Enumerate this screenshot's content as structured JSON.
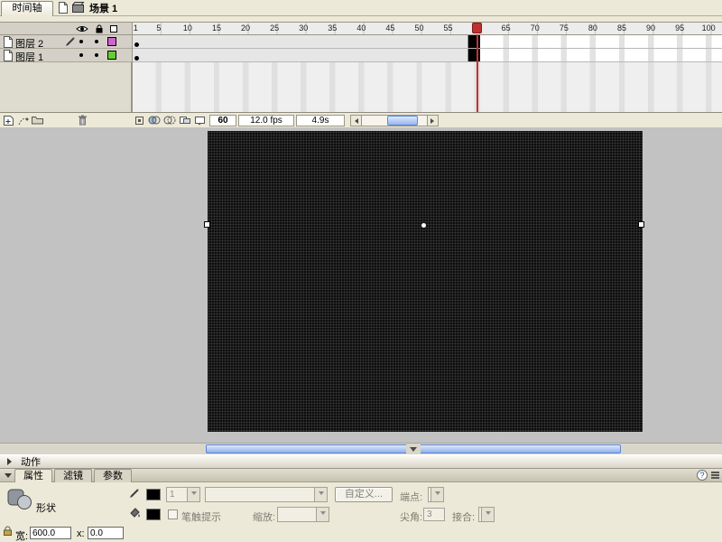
{
  "top": {
    "timeline_tab": "时间轴",
    "scene_label": "场景 1"
  },
  "timeline": {
    "ruler_frames": [
      1,
      5,
      10,
      15,
      20,
      25,
      30,
      35,
      40,
      45,
      50,
      55,
      60,
      65,
      70,
      75,
      80,
      85,
      90,
      95,
      100
    ],
    "current_frame": 60,
    "frame_rate": "12.0 fps",
    "elapsed_time": "4.9s",
    "keyframes": {
      "start": 1,
      "end": 60
    },
    "layers": [
      {
        "name": "图层 2",
        "outline_color": "#cc66cc",
        "active": true
      },
      {
        "name": "图层 1",
        "outline_color": "#66cc33",
        "active": false
      }
    ]
  },
  "actions_panel": {
    "label": "动作"
  },
  "properties": {
    "tabs": [
      {
        "id": "properties",
        "label": "属性",
        "active": true
      },
      {
        "id": "filters",
        "label": "滤镜",
        "active": false
      },
      {
        "id": "parameters",
        "label": "参数",
        "active": false
      }
    ],
    "object_type": "形状",
    "stroke_height": "1",
    "custom_button": "自定义...",
    "cap_label": "端点:",
    "stroke_hint_label": "笔触提示",
    "scale_label": "缩放:",
    "miter_label": "尖角:",
    "miter_value": "3",
    "join_label": "接合:",
    "size": {
      "width_label": "宽:",
      "width_value": "600.0",
      "x_label": "x:",
      "x_value": "0.0"
    }
  }
}
